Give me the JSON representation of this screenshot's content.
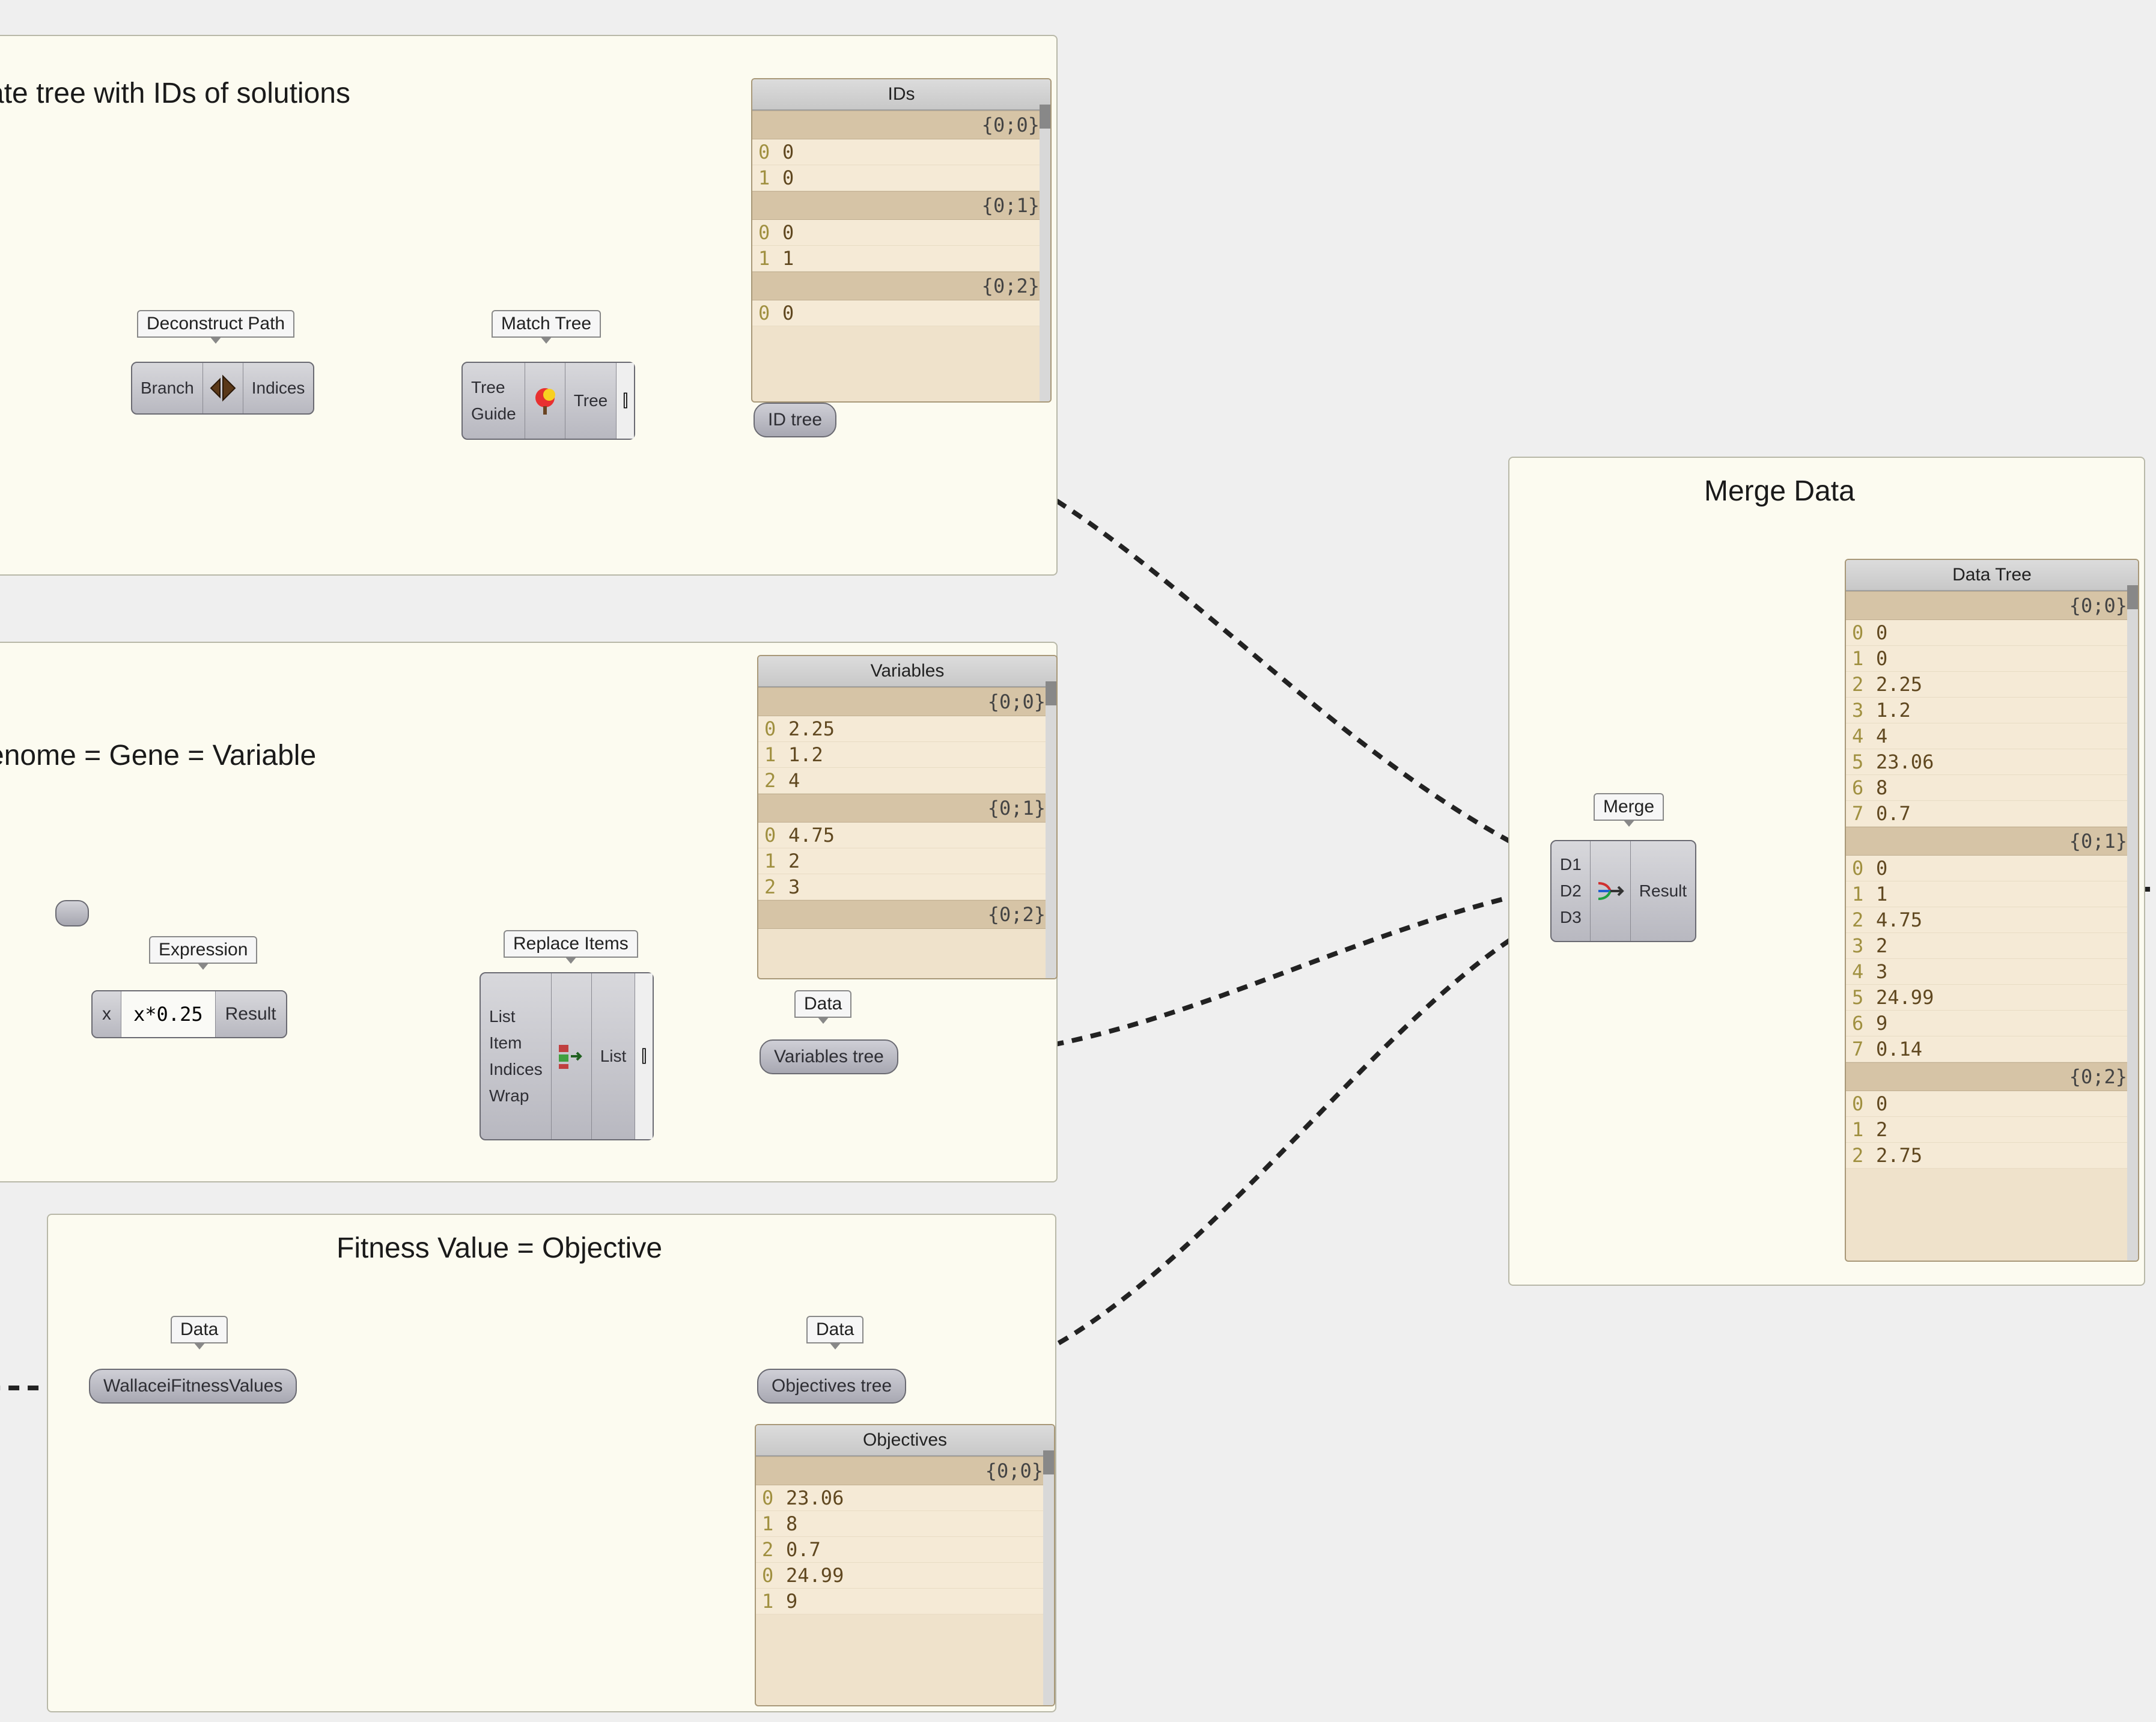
{
  "groups": {
    "g1": {
      "title": "ate tree with IDs of solutions"
    },
    "g2": {
      "title": "enome = Gene = Variable"
    },
    "g3": {
      "title": "Fitness Value = Objective"
    },
    "g4": {
      "title": "Merge Data"
    }
  },
  "labels": {
    "deconstructPath": "Deconstruct Path",
    "matchTree": "Match Tree",
    "expression": "Expression",
    "replaceItems": "Replace Items",
    "merge": "Merge",
    "data1": "Data",
    "data2": "Data",
    "data3": "Data"
  },
  "components": {
    "deconstruct": {
      "in": [
        "Branch"
      ],
      "out": [
        "Indices"
      ]
    },
    "matchtree": {
      "in": [
        "Tree",
        "Guide"
      ],
      "out": [
        "Tree"
      ],
      "grip": "⫿"
    },
    "expression": {
      "in": [
        "x"
      ],
      "mid": "x*0.25",
      "out": [
        "Result"
      ]
    },
    "replace": {
      "in": [
        "List",
        "Item",
        "Indices",
        "Wrap"
      ],
      "out": [
        "List"
      ],
      "grip": "⫿"
    },
    "merge": {
      "in": [
        "D1",
        "D2",
        "D3"
      ],
      "out": [
        "Result"
      ]
    }
  },
  "pills": {
    "idtree": "ID tree",
    "vartree": "Variables tree",
    "wallacei": "WallaceiFitnessValues",
    "objtree": "Objectives tree"
  },
  "panels": {
    "ids": {
      "title": "IDs",
      "blocks": [
        {
          "path": "{0;0}",
          "rows": [
            [
              "0",
              "0"
            ],
            [
              "1",
              "0"
            ]
          ]
        },
        {
          "path": "{0;1}",
          "rows": [
            [
              "0",
              "0"
            ],
            [
              "1",
              "1"
            ]
          ]
        },
        {
          "path": "{0;2}",
          "rows": [
            [
              "0",
              "0"
            ]
          ]
        }
      ]
    },
    "variables": {
      "title": "Variables",
      "blocks": [
        {
          "path": "{0;0}",
          "rows": [
            [
              "0",
              "2.25"
            ],
            [
              "1",
              "1.2"
            ],
            [
              "2",
              "4"
            ]
          ]
        },
        {
          "path": "{0;1}",
          "rows": [
            [
              "0",
              "4.75"
            ],
            [
              "1",
              "2"
            ],
            [
              "2",
              "3"
            ]
          ]
        },
        {
          "path": "{0;2}",
          "rows": []
        }
      ]
    },
    "objectives": {
      "title": "Objectives",
      "blocks": [
        {
          "path": "{0;0}",
          "rows": [
            [
              "0",
              "23.06"
            ],
            [
              "1",
              "8"
            ],
            [
              "2",
              "0.7"
            ]
          ]
        },
        {
          "path": "",
          "rows": [
            [
              "0",
              "24.99"
            ],
            [
              "1",
              "9"
            ]
          ]
        }
      ]
    },
    "datatree": {
      "title": "Data Tree",
      "blocks": [
        {
          "path": "{0;0}",
          "rows": [
            [
              "0",
              "0"
            ],
            [
              "1",
              "0"
            ],
            [
              "2",
              "2.25"
            ],
            [
              "3",
              "1.2"
            ],
            [
              "4",
              "4"
            ],
            [
              "5",
              "23.06"
            ],
            [
              "6",
              "8"
            ],
            [
              "7",
              "0.7"
            ]
          ]
        },
        {
          "path": "{0;1}",
          "rows": [
            [
              "0",
              "0"
            ],
            [
              "1",
              "1"
            ],
            [
              "2",
              "4.75"
            ],
            [
              "3",
              "2"
            ],
            [
              "4",
              "3"
            ],
            [
              "5",
              "24.99"
            ],
            [
              "6",
              "9"
            ],
            [
              "7",
              "0.14"
            ]
          ]
        },
        {
          "path": "{0;2}",
          "rows": [
            [
              "0",
              "0"
            ],
            [
              "1",
              "2"
            ],
            [
              "2",
              "2.75"
            ]
          ]
        }
      ]
    }
  }
}
